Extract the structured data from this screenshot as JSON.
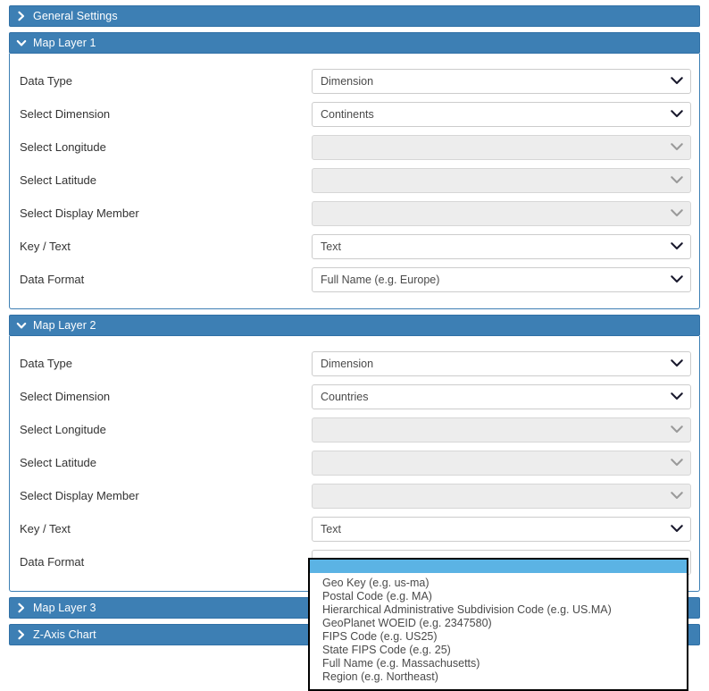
{
  "sections": [
    {
      "id": "general-settings",
      "title": "General Settings",
      "expanded": false,
      "icon": "chevron-right-icon"
    },
    {
      "id": "map-layer-1",
      "title": "Map Layer 1",
      "expanded": true,
      "icon": "chevron-down-icon"
    },
    {
      "id": "map-layer-2",
      "title": "Map Layer 2",
      "expanded": true,
      "icon": "chevron-down-icon"
    },
    {
      "id": "map-layer-3",
      "title": "Map Layer 3",
      "expanded": false,
      "icon": "chevron-right-icon"
    },
    {
      "id": "z-axis-chart",
      "title": "Z-Axis Chart",
      "expanded": false,
      "icon": "chevron-right-icon"
    }
  ],
  "layer1": {
    "rows": [
      {
        "label": "Data Type",
        "value": "Dimension",
        "disabled": false
      },
      {
        "label": "Select Dimension",
        "value": "Continents",
        "disabled": false
      },
      {
        "label": "Select Longitude",
        "value": "",
        "disabled": true
      },
      {
        "label": "Select Latitude",
        "value": "",
        "disabled": true
      },
      {
        "label": "Select Display Member",
        "value": "",
        "disabled": true
      },
      {
        "label": "Key / Text",
        "value": "Text",
        "disabled": false
      },
      {
        "label": "Data Format",
        "value": "Full Name (e.g. Europe)",
        "disabled": false
      }
    ]
  },
  "layer2": {
    "rows": [
      {
        "label": "Data Type",
        "value": "Dimension",
        "disabled": false
      },
      {
        "label": "Select Dimension",
        "value": "Countries",
        "disabled": false
      },
      {
        "label": "Select Longitude",
        "value": "",
        "disabled": true
      },
      {
        "label": "Select Latitude",
        "value": "",
        "disabled": true
      },
      {
        "label": "Select Display Member",
        "value": "",
        "disabled": true
      },
      {
        "label": "Key / Text",
        "value": "Text",
        "disabled": false
      },
      {
        "label": "Data Format",
        "value": "",
        "disabled": false
      }
    ]
  },
  "open_dropdown": {
    "owner": "layer2-data-format",
    "selected_index": 0,
    "options": [
      "",
      "Geo Key (e.g. us-ma)",
      "Postal Code (e.g. MA)",
      "Hierarchical Administrative Subdivision Code (e.g. US.MA)",
      "GeoPlanet WOEID (e.g. 2347580)",
      "FIPS Code (e.g. US25)",
      "State FIPS Code (e.g. 25)",
      "Full Name (e.g. Massachusetts)",
      "Region (e.g. Northeast)"
    ]
  },
  "colors": {
    "header_blue": "#3d7fb4",
    "highlight_blue": "#5bb3e4",
    "disabled_grey": "#ededed",
    "text": "#333333"
  }
}
